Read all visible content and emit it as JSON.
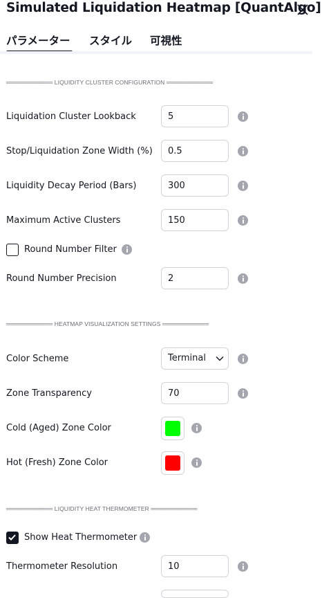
{
  "dialog": {
    "title": "Simulated Liquidation Heatmap [QuantAlgo]"
  },
  "tabs": [
    {
      "label": "パラメーター",
      "active": true
    },
    {
      "label": "スタイル",
      "active": false
    },
    {
      "label": "可視性",
      "active": false
    }
  ],
  "sections": {
    "cluster": "═══════════ LIQUIDITY CLUSTER CONFIGURATION ═══════════",
    "heatmap": "═══════════ HEATMAP VISUALIZATION SETTINGS ═══════════",
    "thermometer": "═══════════ LIQUIDITY HEAT THERMOMETER ═══════════"
  },
  "fields": {
    "lookback": {
      "label": "Liquidation Cluster Lookback",
      "value": "5"
    },
    "zone_width": {
      "label": "Stop/Liquidation Zone Width (%)",
      "value": "0.5"
    },
    "decay": {
      "label": "Liquidity Decay Period (Bars)",
      "value": "300"
    },
    "max_clusters": {
      "label": "Maximum Active Clusters",
      "value": "150"
    },
    "round_filter": {
      "label": "Round Number Filter",
      "checked": false
    },
    "round_precision": {
      "label": "Round Number Precision",
      "value": "2"
    },
    "color_scheme": {
      "label": "Color Scheme",
      "value": "Terminal"
    },
    "transparency": {
      "label": "Zone Transparency",
      "value": "70"
    },
    "cold_color": {
      "label": "Cold (Aged) Zone Color",
      "color": "#00ff00"
    },
    "hot_color": {
      "label": "Hot (Fresh) Zone Color",
      "color": "#ff0000"
    },
    "show_thermo": {
      "label": "Show Heat Thermometer",
      "checked": true
    },
    "thermo_resolution": {
      "label": "Thermometer Resolution",
      "value": "10"
    }
  },
  "icons": {
    "close": "close-icon",
    "info": "info-icon",
    "chevron": "chevron-down-icon",
    "check": "check-icon"
  }
}
